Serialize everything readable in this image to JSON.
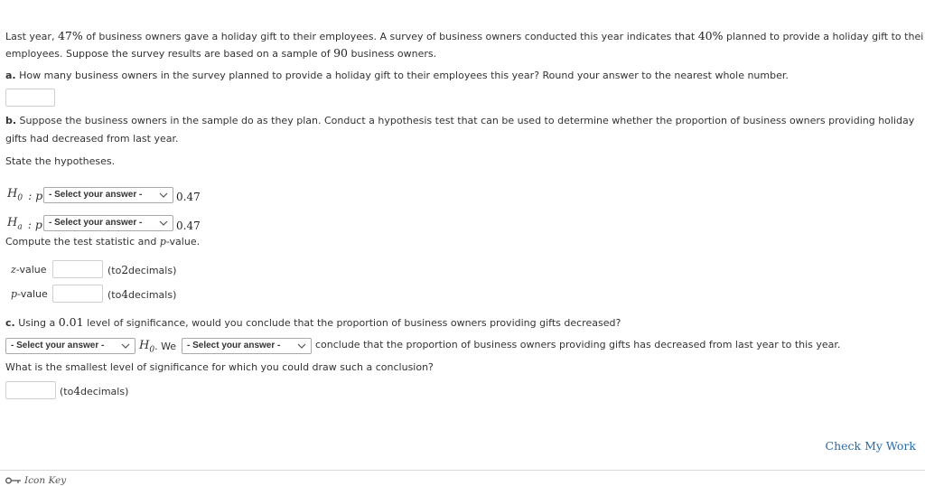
{
  "problem": {
    "intro_p1": "Last year, ",
    "pct_last_year": "47%",
    "intro_p2": " of business owners gave a holiday gift to their employees. A survey of business owners conducted this year indicates that ",
    "pct_this_year": "40%",
    "intro_p3": " planned to provide a holiday gift to thei",
    "intro_line2_a": "employees. Suppose the survey results are based on a sample of ",
    "sample_size": "90",
    "intro_line2_b": " business owners."
  },
  "part_a": {
    "label": "a.",
    "text": " How many business owners in the survey planned to provide a holiday gift to their employees this year? Round your answer to the nearest whole number.",
    "answer": ""
  },
  "part_b": {
    "label": "b.",
    "text_line1": " Suppose the business owners in the sample do as they plan. Conduct a hypothesis test that can be used to determine whether the proportion of business owners providing holiday",
    "text_line2": "gifts had decreased from last year.",
    "state": "State the hypotheses.",
    "h0_symbol": "H",
    "h0_sub": "0",
    "ha_symbol": "H",
    "ha_sub": "a",
    "p_label": ": p",
    "select_placeholder": "- Select your answer -",
    "h0_value": "0.47",
    "ha_value": "0.47",
    "compute": "Compute the test statistic and ",
    "compute_p": "p",
    "compute_end": "-value.",
    "z_label": "z",
    "z_label_tail": "-value",
    "p_label2": "p",
    "p_label2_tail": "-value",
    "to_2_a": "(to ",
    "to_2_n": "2",
    "to_2_b": " decimals)",
    "to_4_a": "(to ",
    "to_4_n": "4",
    "to_4_b": " decimals)"
  },
  "part_c": {
    "label": "c.",
    "text_a": " Using a ",
    "alpha": "0.01",
    "text_b": " level of significance, would you conclude that the proportion of business owners providing gifts decreased?",
    "select1": "- Select your answer -",
    "h0_symbol": "H",
    "h0_sub": "0",
    "we": ". We",
    "select2": "- Select your answer -",
    "conclude": "conclude that the proportion of business owners providing gifts has decreased from last year to this year.",
    "smallest": "What is the smallest level of significance for which you could draw such a conclusion?",
    "to_a": "(to ",
    "to_n": "4",
    "to_b": " decimals)"
  },
  "footer": {
    "check": "Check My Work",
    "icon_key": "Icon Key"
  }
}
